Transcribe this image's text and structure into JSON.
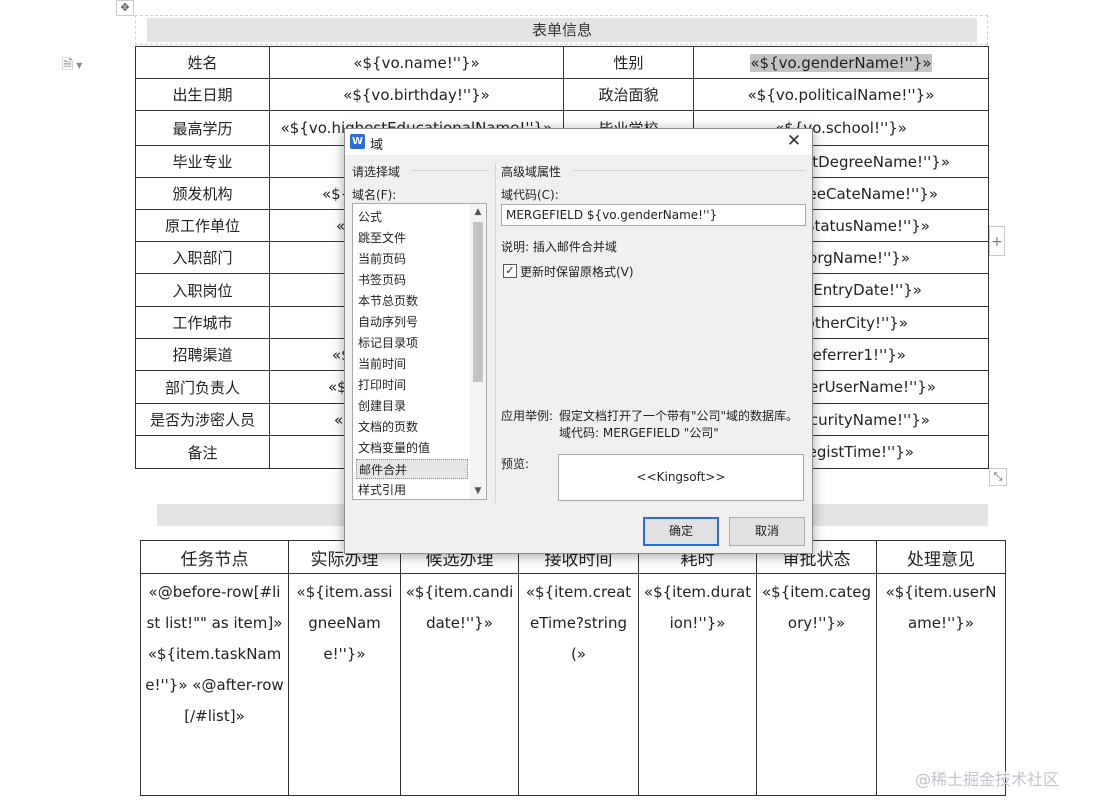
{
  "form": {
    "header": "表单信息",
    "rows": [
      [
        "姓名",
        "«${vo.name!''}»",
        "性别",
        "«${vo.genderName!''}»"
      ],
      [
        "出生日期",
        "«${vo.birthday!''}»",
        "政治面貌",
        "«${vo.politicalName!''}»"
      ],
      [
        "最高学历",
        "«${vo.highestEducationalName!''}»",
        "毕业学校",
        "«${vo.school!''}»"
      ],
      [
        "毕业专业",
        "",
        "",
        "stDegreeName!''}»"
      ],
      [
        "颁发机构",
        "«${",
        "",
        "reeCateName!''}»"
      ],
      [
        "原工作单位",
        "«",
        "",
        "StatusName!''}»"
      ],
      [
        "入职部门",
        "",
        "",
        "orgName!''}»"
      ],
      [
        "入职岗位",
        "",
        "",
        "eEntryDate!''}»"
      ],
      [
        "工作城市",
        "",
        "",
        "otherCity!''}»"
      ],
      [
        "招聘渠道",
        "«$",
        "",
        ".referrer1!''}»"
      ],
      [
        "部门负责人",
        "«$",
        "",
        "derUserName!''}»"
      ],
      [
        "是否为涉密人员",
        "«",
        "",
        "curityName!''}»"
      ],
      [
        "备注",
        "",
        "",
        "registTime!''}»"
      ]
    ]
  },
  "tasks": {
    "headers": [
      "任务节点",
      "实际办理",
      "候选办理",
      "接收时间",
      "耗时",
      "审批状态",
      "处理意见"
    ],
    "row": [
      "«@before-row[#list list!\"\" as item]» «${item.taskName!''}» «@after-row[/#list]»",
      "«${item.assigneeName!''}»",
      "«${item.candidate!''}»",
      "«${item.createTime?string(»",
      "«${item.duration!''}»",
      "«${item.category!''}»",
      "«${item.userName!''}»"
    ]
  },
  "dialog": {
    "title": "域",
    "select_group_label": "请选择域",
    "field_name_label": "域名(F):",
    "field_list": [
      "公式",
      "跳至文件",
      "当前页码",
      "书签页码",
      "本节总页数",
      "自动序列号",
      "标记目录项",
      "当前时间",
      "打印时间",
      "创建目录",
      "文档的页数",
      "文档变量的值",
      "邮件合并",
      "样式引用"
    ],
    "selected_index": 12,
    "advanced_group_label": "高级域属性",
    "field_code_label": "域代码(C):",
    "field_code_value": "MERGEFIELD  ${vo.genderName!''}",
    "description": "说明: 插入邮件合并域",
    "keep_format_label": "更新时保留原格式(V)",
    "keep_format_checked": true,
    "example_label": "应用举例:",
    "example_line1": "假定文档打开了一个带有\"公司\"域的数据库。",
    "example_line2": "域代码: MERGEFIELD \"公司\"",
    "preview_label": "预览:",
    "preview_value": "<<Kingsoft>>",
    "ok_label": "确定",
    "cancel_label": "取消"
  },
  "watermark": "@稀土掘金技术社区",
  "icons": {
    "move": "move-icon",
    "doc": "document-icon",
    "add": "plus-icon",
    "resize": "resize-icon",
    "app": "wps-writer-icon",
    "close": "close-icon",
    "check": "check-icon"
  }
}
